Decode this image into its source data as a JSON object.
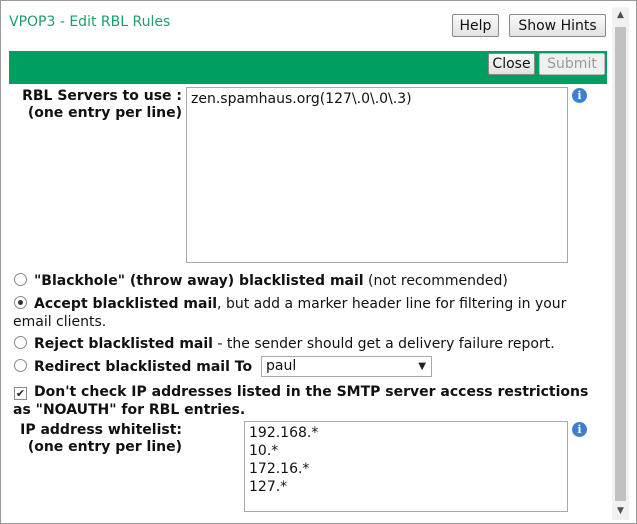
{
  "header": {
    "title": "VPOP3 - Edit RBL Rules",
    "help_label": "Help",
    "hints_label": "Show Hints"
  },
  "toolbar": {
    "close_label": "Close",
    "submit_label": "Submit"
  },
  "rbl": {
    "label_line1": "RBL Servers to use :",
    "label_line2": "(one entry per line)",
    "value": "zen.spamhaus.org(127\\.0\\.0\\.3)"
  },
  "options": {
    "blackhole": {
      "bold": "\"Blackhole\" (throw away) blacklisted mail",
      "rest": " (not recommended)",
      "selected": false
    },
    "accept": {
      "bold": "Accept blacklisted mail",
      "rest": ", but add a marker header line for filtering in your email clients.",
      "selected": true
    },
    "reject": {
      "bold": "Reject blacklisted mail",
      "rest": " - the sender should get a delivery failure report.",
      "selected": false
    },
    "redirect": {
      "bold": "Redirect blacklisted mail To",
      "selected": false,
      "target": "paul"
    },
    "noauth": {
      "label": "Don't check IP addresses listed in the SMTP server access restrictions as \"NOAUTH\" for RBL entries.",
      "checked": true
    }
  },
  "whitelist": {
    "label_line1": "IP address whitelist:",
    "label_line2": "(one entry per line)",
    "value": "192.168.*\n10.*\n172.16.*\n127.*"
  },
  "icons": {
    "info": "i",
    "dropdown": "▼",
    "check": "✔",
    "scroll_up": "▲",
    "scroll_down": "▼"
  },
  "colors": {
    "accent_green": "#009e60",
    "title_green": "#1a9e6a",
    "info_blue": "#3a7fd0"
  }
}
